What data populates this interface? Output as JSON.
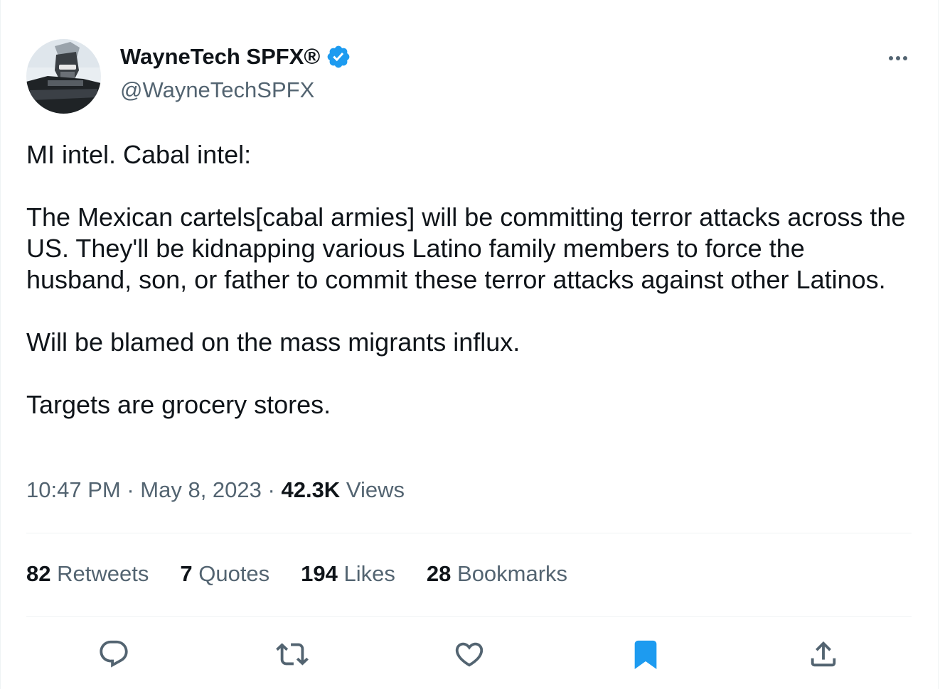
{
  "author": {
    "display_name": "WayneTech SPFX®",
    "handle": "@WayneTechSPFX",
    "verified": true
  },
  "tweet": {
    "paragraphs": [
      "MI intel. Cabal intel:",
      "The Mexican cartels[cabal armies] will be committing terror attacks across the US. They'll be kidnapping various Latino family members to force the husband, son, or father to commit these terror attacks against other Latinos.",
      "Will be blamed on the mass migrants influx.",
      "Targets are grocery stores."
    ],
    "time": "10:47 PM",
    "date": "May 8, 2023",
    "views_count": "42.3K",
    "views_label": "Views",
    "separator": "·"
  },
  "stats": {
    "retweets": {
      "count": "82",
      "label": "Retweets"
    },
    "quotes": {
      "count": "7",
      "label": "Quotes"
    },
    "likes": {
      "count": "194",
      "label": "Likes"
    },
    "bookmarks": {
      "count": "28",
      "label": "Bookmarks"
    }
  },
  "colors": {
    "accent": "#1d9bf0",
    "text": "#0f1419",
    "secondary": "#536471",
    "divider": "#eff3f4"
  },
  "icons": [
    "more-icon",
    "verified-icon",
    "reply-icon",
    "retweet-icon",
    "like-icon",
    "bookmark-icon",
    "share-icon"
  ]
}
